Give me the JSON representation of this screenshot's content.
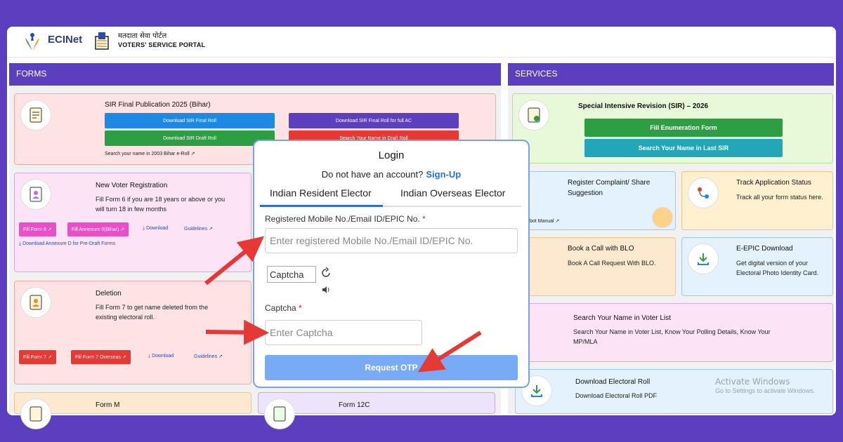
{
  "header": {
    "logo_text": "ECINet",
    "portal_hindi": "मतदाता सेवा पोर्टल",
    "portal_english": "VOTERS' SERVICE PORTAL"
  },
  "forms_panel": {
    "title": "FORMS",
    "sir_card": {
      "title": "SIR Final Publication 2025 (Bihar)",
      "btn_final_roll": "Download SIR Final Roll",
      "btn_final_roll_ac": "Download SIR Final Roll for full AC",
      "btn_draft_roll": "Download SIR Draft Roll",
      "btn_search_draft": "Search Your Name in Draft Roll",
      "search_2003": "Search your name in 2003 Bihar e-Roll"
    },
    "new_voter": {
      "title": "New Voter Registration",
      "desc_line1": "Fill Form 6 if you are 18 years or above or you",
      "desc_line2": "will turn 18 in few months",
      "btn_form6": "Fill Form 6",
      "btn_annexure": "Fill Annexure 0(Bihar)",
      "download": "Download",
      "guidelines": "Guidelines",
      "annexure_d": "Download Annexure D for Pre-Draft Forms"
    },
    "deletion": {
      "title": "Deletion",
      "desc_line1": "Fill Form 7 to get name deleted from the",
      "desc_line2": "existing electoral roll.",
      "btn_form7": "Fill Form 7",
      "btn_form7_overseas": "Fill Form 7 Overseas",
      "download": "Download",
      "guidelines": "Guidelines"
    },
    "form_m": {
      "title": "Form M"
    },
    "form_12c": {
      "title": "Form 12C"
    }
  },
  "services_panel": {
    "title": "SERVICES",
    "sir_2026": {
      "title": "Special Intensive Revision (SIR) – 2026",
      "btn_fill": "Fill Enumeration Form",
      "btn_search": "Search Your Name in Last SIR"
    },
    "complaint": {
      "title_line1": "Register Complaint/ Share",
      "title_line2": "Suggestion",
      "chatbot": "tbot Manual"
    },
    "track": {
      "title": "Track Application Status",
      "desc": "Track all your form status here."
    },
    "blo": {
      "title": "Book a Call with BLO",
      "desc": "Book A Call Request With BLO."
    },
    "epic": {
      "title": "E-EPIC Download",
      "desc_line1": "Get digital version of your",
      "desc_line2": "Electoral Photo Identity Card."
    },
    "voter_list": {
      "title": "Search Your Name in Voter List",
      "desc_line1": "Search Your Name in Voter List, Know Your Polling Details, Know Your",
      "desc_line2": "MP/MLA"
    },
    "electoral_roll": {
      "title": "Download Electoral Roll",
      "desc": "Download Electoral Roll PDF"
    }
  },
  "login": {
    "title": "Login",
    "no_account": "Do not have an account?",
    "signup": "Sign-Up",
    "tab_resident": "Indian Resident Elector",
    "tab_overseas": "Indian Overseas Elector",
    "mobile_label": "Registered Mobile No./Email ID/EPIC No.",
    "required_mark": "*",
    "mobile_placeholder": "Enter registered Mobile No./Email ID/EPIC No.",
    "captcha_alt": "Captcha",
    "captcha_label": "Captcha",
    "captcha_placeholder": "Enter Captcha",
    "request_otp": "Request OTP"
  },
  "watermark": {
    "line1": "Activate Windows",
    "line2": "Go to Settings to activate Windows."
  },
  "colors": {
    "purple": "#5b3fbf",
    "blue_btn": "#1e88e5",
    "green_btn": "#2e9e44",
    "teal_btn": "#23a6b8",
    "red_btn": "#e53935",
    "arrow_red": "#e53935"
  }
}
